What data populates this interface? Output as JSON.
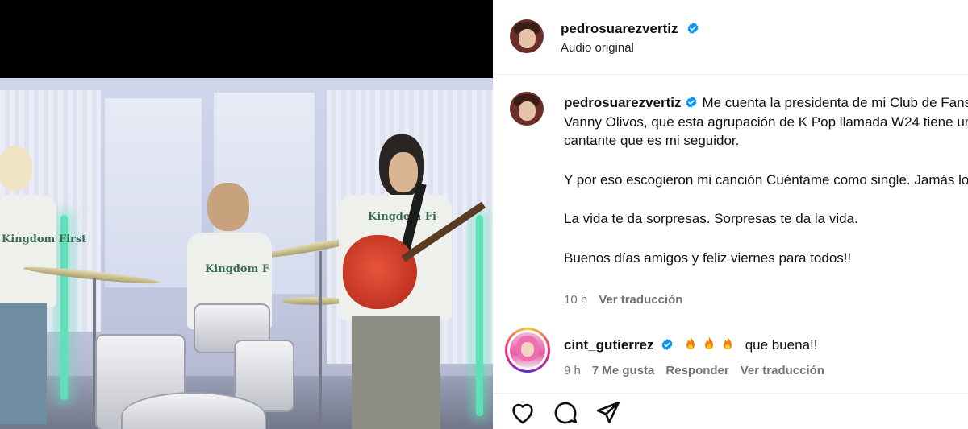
{
  "post": {
    "author": "pedrosuarezvertiz",
    "audio": "Audio original",
    "caption_lines": [
      "Me cuenta la presidenta de mi Club de Fans, Vanny Olivos, que esta agrupación de K Pop llamada W24 tiene un cantante que es mi seguidor.",
      "Y por eso escogieron mi canción Cuéntame como single. Jamás lo pensé.",
      "La vida te da sorpresas. Sorpresas te da la vida.",
      "Buenos días amigos y feliz viernes para todos!!"
    ],
    "time": "10 h",
    "translate": "Ver traducción"
  },
  "video": {
    "shirt_text_1": "Kingdom First",
    "shirt_text_2": "Kingdom F",
    "shirt_text_3": "Kingdom Fi"
  },
  "comment": {
    "author": "cint_gutierrez",
    "text": "que buena!!",
    "time": "9 h",
    "likes": "7 Me gusta",
    "reply": "Responder",
    "translate": "Ver traducción"
  },
  "icons": {
    "like": "heart-icon",
    "comment": "comment-icon",
    "share": "share-icon",
    "verified": "verified-badge-icon",
    "fire": "fire-emoji"
  },
  "colors": {
    "verified": "#0095f6",
    "secondary_text": "#737373",
    "neon": "#5fe0b8",
    "guitar": "#c9321f"
  }
}
